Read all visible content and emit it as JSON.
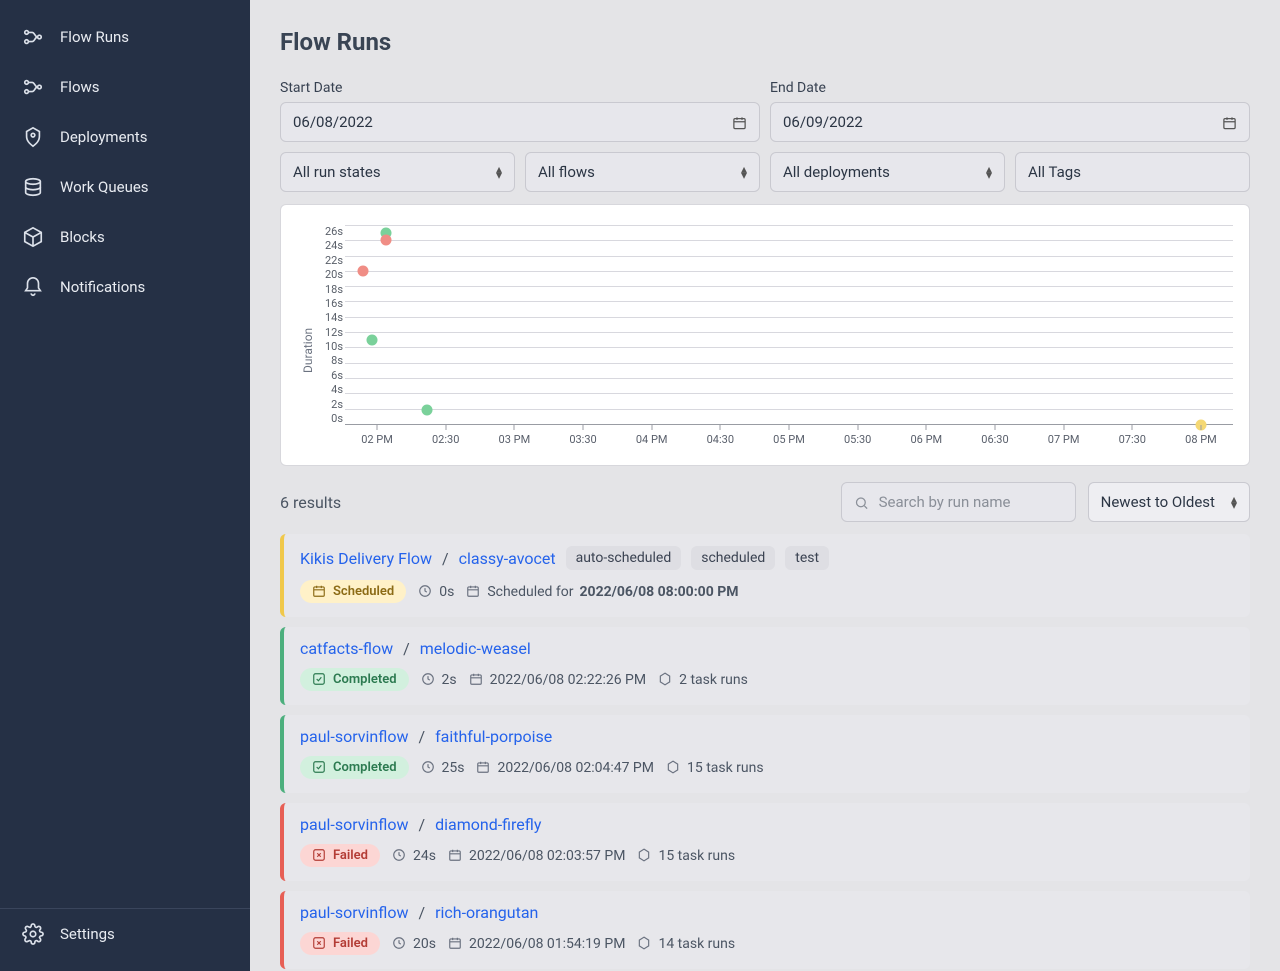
{
  "sidebar": {
    "items": [
      {
        "label": "Flow Runs",
        "icon": "flow-runs-icon"
      },
      {
        "label": "Flows",
        "icon": "flows-icon"
      },
      {
        "label": "Deployments",
        "icon": "deployments-icon"
      },
      {
        "label": "Work Queues",
        "icon": "work-queues-icon"
      },
      {
        "label": "Blocks",
        "icon": "blocks-icon"
      },
      {
        "label": "Notifications",
        "icon": "notifications-icon"
      }
    ],
    "settings_label": "Settings"
  },
  "page": {
    "title": "Flow Runs"
  },
  "filters": {
    "start_date_label": "Start Date",
    "start_date_value": "06/08/2022",
    "end_date_label": "End Date",
    "end_date_value": "06/09/2022",
    "run_states": "All run states",
    "flows": "All flows",
    "deployments": "All deployments",
    "tags": "All Tags"
  },
  "chart_data": {
    "type": "scatter",
    "ylabel": "Duration",
    "yticks": [
      "26s",
      "24s",
      "22s",
      "20s",
      "18s",
      "16s",
      "14s",
      "12s",
      "10s",
      "8s",
      "6s",
      "4s",
      "2s",
      "0s"
    ],
    "xticks": [
      "02 PM",
      "02:30",
      "03 PM",
      "03:30",
      "04 PM",
      "04:30",
      "05 PM",
      "05:30",
      "06 PM",
      "06:30",
      "07 PM",
      "07:30",
      "08 PM"
    ],
    "x_range_minutes": [
      106,
      494
    ],
    "y_range_seconds": [
      0,
      26
    ],
    "series": [
      {
        "name": "Completed",
        "color": "#7ad19a",
        "points": [
          {
            "x_min": 124,
            "y_sec": 25
          },
          {
            "x_min": 142,
            "y_sec": 2
          },
          {
            "x_min": 118,
            "y_sec": 11
          }
        ]
      },
      {
        "name": "Failed",
        "color": "#f08d85",
        "points": [
          {
            "x_min": 124,
            "y_sec": 24
          },
          {
            "x_min": 114,
            "y_sec": 20
          }
        ]
      },
      {
        "name": "Scheduled",
        "color": "#f5d874",
        "points": [
          {
            "x_min": 480,
            "y_sec": 0
          }
        ]
      }
    ]
  },
  "results": {
    "count_text": "6 results",
    "search_placeholder": "Search by run name",
    "sort": "Newest to Oldest"
  },
  "runs": [
    {
      "flow": "Kikis Delivery Flow",
      "run": "classy-avocet",
      "tags": [
        "auto-scheduled",
        "scheduled",
        "test"
      ],
      "state": "Scheduled",
      "state_class": "scheduled",
      "border": "yellow",
      "duration": "0s",
      "timestamp_prefix": "Scheduled for ",
      "timestamp_bold": "2022/06/08 08:00:00 PM",
      "task_runs": null
    },
    {
      "flow": "catfacts-flow",
      "run": "melodic-weasel",
      "tags": [],
      "state": "Completed",
      "state_class": "completed",
      "border": "green",
      "duration": "2s",
      "timestamp": "2022/06/08 02:22:26 PM",
      "task_runs": "2 task runs"
    },
    {
      "flow": "paul-sorvinflow",
      "run": "faithful-porpoise",
      "tags": [],
      "state": "Completed",
      "state_class": "completed",
      "border": "green",
      "duration": "25s",
      "timestamp": "2022/06/08 02:04:47 PM",
      "task_runs": "15 task runs"
    },
    {
      "flow": "paul-sorvinflow",
      "run": "diamond-firefly",
      "tags": [],
      "state": "Failed",
      "state_class": "failed",
      "border": "red",
      "duration": "24s",
      "timestamp": "2022/06/08 02:03:57 PM",
      "task_runs": "15 task runs"
    },
    {
      "flow": "paul-sorvinflow",
      "run": "rich-orangutan",
      "tags": [],
      "state": "Failed",
      "state_class": "failed",
      "border": "red",
      "duration": "20s",
      "timestamp": "2022/06/08 01:54:19 PM",
      "task_runs": "14 task runs"
    }
  ]
}
